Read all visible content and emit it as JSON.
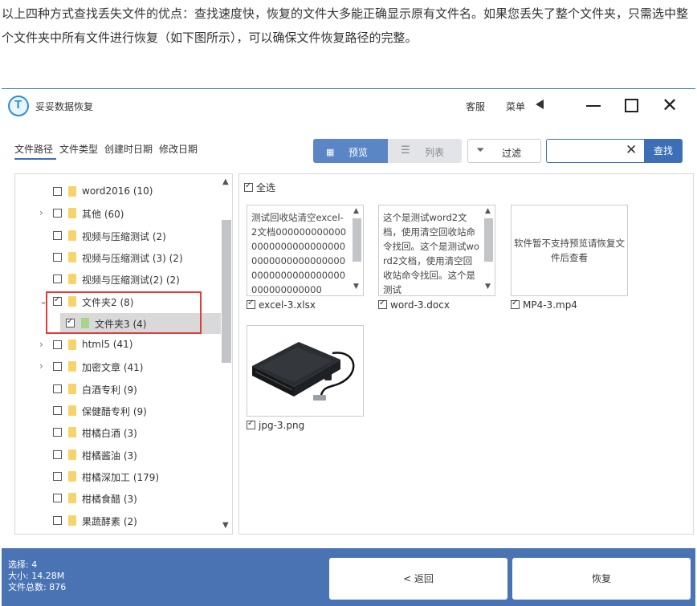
{
  "intro_text": "以上四种方式查找丢失文件的优点：查找速度快，恢复的文件大多能正确显示原有文件名。如果您丢失了整个文件夹，只需选中整个文件夹中所有文件进行恢复（如下图所示），可以确保文件恢复路径的完整。",
  "app": {
    "title": "妥妥数据恢复",
    "logo_letter": "T",
    "service_label": "客服",
    "menu_label": "菜单",
    "colors": {
      "accent": "#3d6fb6",
      "footer": "#4a73b3",
      "highlight": "#e23b3b"
    }
  },
  "toolbar": {
    "tabs": [
      "文件路径",
      "文件类型",
      "创建时日期",
      "修改日期"
    ],
    "active_tab": "文件路径",
    "preview_label": "预览",
    "list_label": "列表",
    "filter_label": "过滤",
    "search_value": "",
    "search_label": "查找"
  },
  "tree": {
    "items": [
      {
        "label": "word2016 (10)",
        "has_arrow": false,
        "checked": false,
        "indent": 0,
        "folder": "yellow"
      },
      {
        "label": "其他 (60)",
        "has_arrow": true,
        "arrow": "›",
        "checked": false,
        "indent": 0,
        "folder": "yellow"
      },
      {
        "label": "视频与压缩测试 (2)",
        "has_arrow": false,
        "checked": false,
        "indent": 0,
        "folder": "yellow"
      },
      {
        "label": "视频与压缩测试 (3) (2)",
        "has_arrow": false,
        "checked": false,
        "indent": 0,
        "folder": "yellow"
      },
      {
        "label": "视频与压缩测试(2) (2)",
        "has_arrow": false,
        "checked": false,
        "indent": 0,
        "folder": "yellow"
      },
      {
        "label": "文件夹2 (8)",
        "has_arrow": true,
        "arrow": "⌄",
        "checked": true,
        "indent": 0,
        "folder": "yellow"
      },
      {
        "label": "文件夹3 (4)",
        "has_arrow": false,
        "checked": true,
        "indent": 1,
        "folder": "green",
        "selected": true
      },
      {
        "label": "html5 (41)",
        "has_arrow": true,
        "arrow": "›",
        "checked": false,
        "indent": 0,
        "folder": "yellow"
      },
      {
        "label": "加密文章 (41)",
        "has_arrow": true,
        "arrow": "›",
        "checked": false,
        "indent": 0,
        "folder": "yellow"
      },
      {
        "label": "白酒专利 (9)",
        "has_arrow": false,
        "checked": false,
        "indent": 0,
        "folder": "yellow"
      },
      {
        "label": "保健醋专利 (9)",
        "has_arrow": false,
        "checked": false,
        "indent": 0,
        "folder": "yellow"
      },
      {
        "label": "柑橘白酒 (3)",
        "has_arrow": false,
        "checked": false,
        "indent": 0,
        "folder": "yellow"
      },
      {
        "label": "柑橘酱油 (3)",
        "has_arrow": false,
        "checked": false,
        "indent": 0,
        "folder": "yellow"
      },
      {
        "label": "柑橘深加工 (179)",
        "has_arrow": false,
        "checked": false,
        "indent": 0,
        "folder": "yellow"
      },
      {
        "label": "柑橘食醋 (3)",
        "has_arrow": false,
        "checked": false,
        "indent": 0,
        "folder": "yellow"
      },
      {
        "label": "果蔬酵素 (2)",
        "has_arrow": false,
        "checked": false,
        "indent": 0,
        "folder": "yellow"
      }
    ]
  },
  "content": {
    "select_all_label": "全选",
    "files": [
      {
        "name": "excel-3.xlsx",
        "type": "text",
        "preview": "测试回收站清空excel-2文档000000000000000000000000000000000000000000000000000000000000000000000000",
        "checked": true
      },
      {
        "name": "word-3.docx",
        "type": "text",
        "preview": "这个是测试word2文档，使用清空回收站命令找回。这个是测试word2文档，使用清空回收站命令找回。这个是测试",
        "checked": true
      },
      {
        "name": "MP4-3.mp4",
        "type": "unsupported",
        "preview": "软件暂不支持预览请恢复文件后查看",
        "checked": true
      },
      {
        "name": "jpg-3.png",
        "type": "image",
        "preview": "",
        "checked": true
      }
    ]
  },
  "footer": {
    "selected_label": "选择: 4",
    "size_label": "大小: 14.28M",
    "total_label": "文件总数: 876",
    "back_label": "< 返回",
    "recover_label": "恢复"
  }
}
